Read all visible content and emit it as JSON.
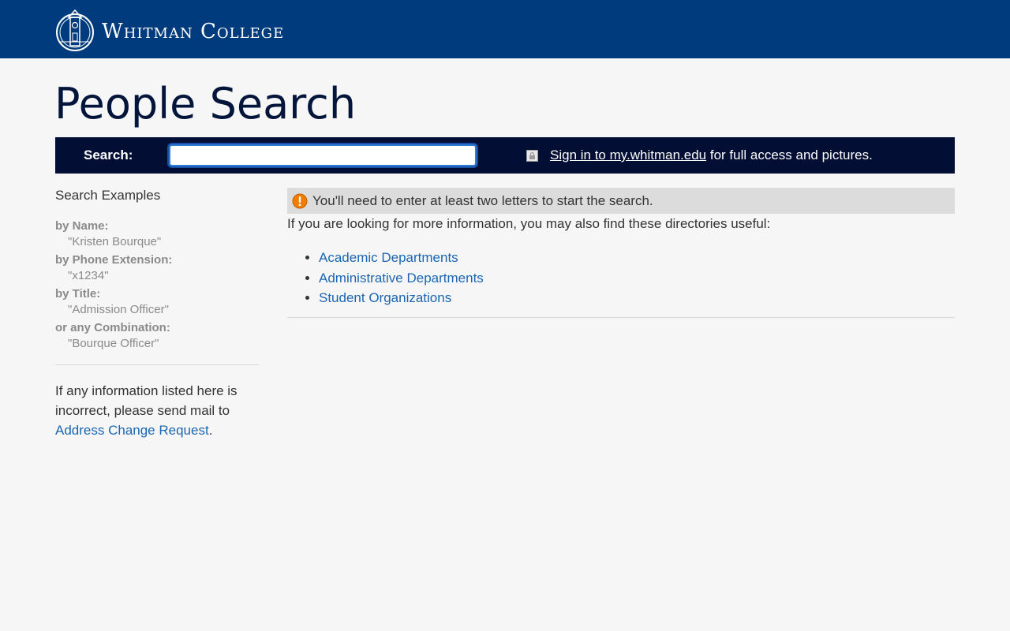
{
  "header": {
    "college_name": "Whitman College"
  },
  "page": {
    "title": "People Search"
  },
  "searchbar": {
    "label": "Search:",
    "input_value": "",
    "signin_link": "Sign in to my.whitman.edu",
    "signin_suffix": " for full access and pictures."
  },
  "sidebar": {
    "heading": "Search Examples",
    "examples": [
      {
        "label": "by Name:",
        "value": "\"Kristen Bourque\""
      },
      {
        "label": "by Phone Extension:",
        "value": "\"x1234\""
      },
      {
        "label": "by Title:",
        "value": "\"Admission Officer\""
      },
      {
        "label": "or any Combination:",
        "value": "\"Bourque Officer\""
      }
    ],
    "note_prefix": "If any information listed here is incorrect, please send mail to ",
    "note_link": "Address Change Request",
    "note_suffix": "."
  },
  "main": {
    "notice": "You'll need to enter at least two letters to start the search.",
    "intro": "If you are looking for more information, you may also find these directories useful:",
    "directories": [
      "Academic Departments",
      "Administrative Departments",
      "Student Organizations"
    ]
  },
  "colors": {
    "header_bg": "#003c7d",
    "searchbar_bg": "#020e33",
    "link": "#1a66b3",
    "warning": "#f07d00"
  }
}
